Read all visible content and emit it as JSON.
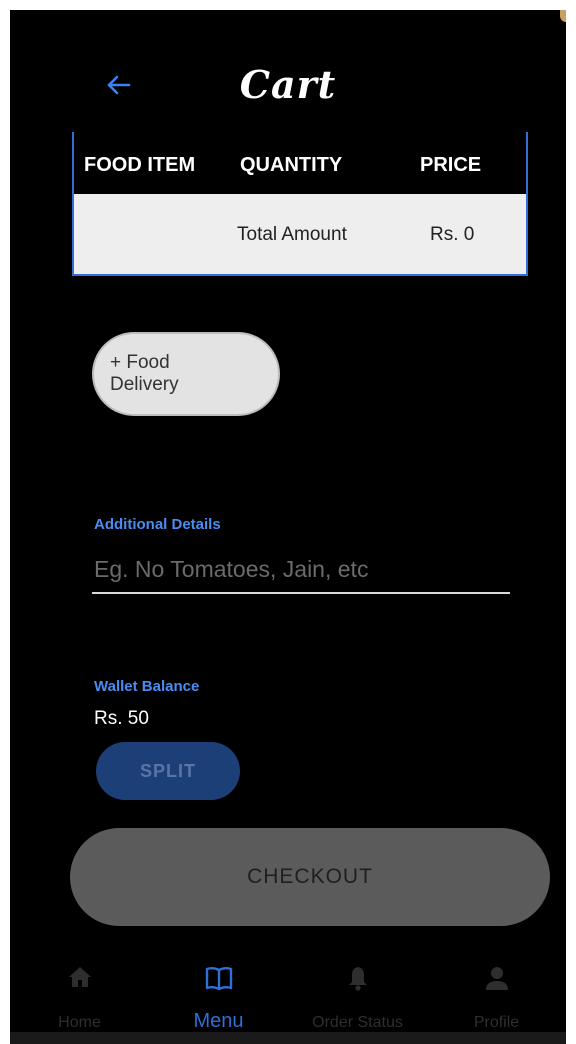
{
  "header": {
    "title": "Cart",
    "back_icon": "arrow-left-icon"
  },
  "table": {
    "headers": [
      "FOOD ITEM",
      "QUANTITY",
      "PRICE"
    ],
    "total_label": "Total Amount",
    "total_value": "Rs. 0"
  },
  "delivery_chip": {
    "label": "+ Food Delivery"
  },
  "additional_details": {
    "label": "Additional Details",
    "placeholder": "Eg. No Tomatoes, Jain, etc",
    "value": ""
  },
  "wallet": {
    "label": "Wallet Balance",
    "value": "Rs. 50",
    "split_label": "SPLIT"
  },
  "checkout": {
    "label": "CHECKOUT"
  },
  "nav": {
    "items": [
      {
        "label": "Home",
        "icon": "home-icon",
        "active": false
      },
      {
        "label": "Menu",
        "icon": "book-icon",
        "active": true
      },
      {
        "label": "Order Status",
        "icon": "bell-icon",
        "active": false
      },
      {
        "label": "Profile",
        "icon": "person-icon",
        "active": false
      }
    ]
  },
  "colors": {
    "accent": "#2f6fd6",
    "background": "#000000",
    "label_blue": "#4a8cf0"
  }
}
